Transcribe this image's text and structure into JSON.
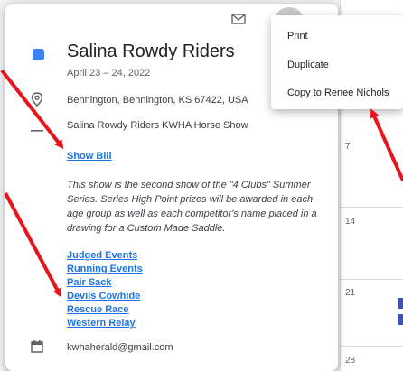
{
  "calendar": {
    "days": [
      "7",
      "14",
      "21",
      "28"
    ]
  },
  "event": {
    "color": "#3b82f6",
    "title": "Salina Rowdy Riders",
    "date": "April 23 – 24, 2022",
    "location": "Bennington, Bennington, KS 67422, USA",
    "description_title": "Salina Rowdy Riders KWHA Horse Show",
    "show_bill_link": "Show Bill",
    "description": "This show is the second show of the \"4 Clubs\" Summer Series. Series High Point prizes will be awarded in each age group as well as each competitor's name placed in a drawing for a Custom Made Saddle.",
    "links": [
      "Judged Events",
      "Running Events",
      "Pair Sack",
      "Devils Cowhide",
      "Rescue Race",
      "Western Relay"
    ],
    "organizer_email": "kwhaherald@gmail.com"
  },
  "menu": {
    "items": [
      "Print",
      "Duplicate",
      "Copy to Renee Nichols"
    ]
  },
  "icons": {
    "mail": "mail-icon",
    "location": "location-pin-icon",
    "description": "description-lines-icon",
    "calendar": "calendar-icon"
  },
  "annotation_color": "#e8141b"
}
